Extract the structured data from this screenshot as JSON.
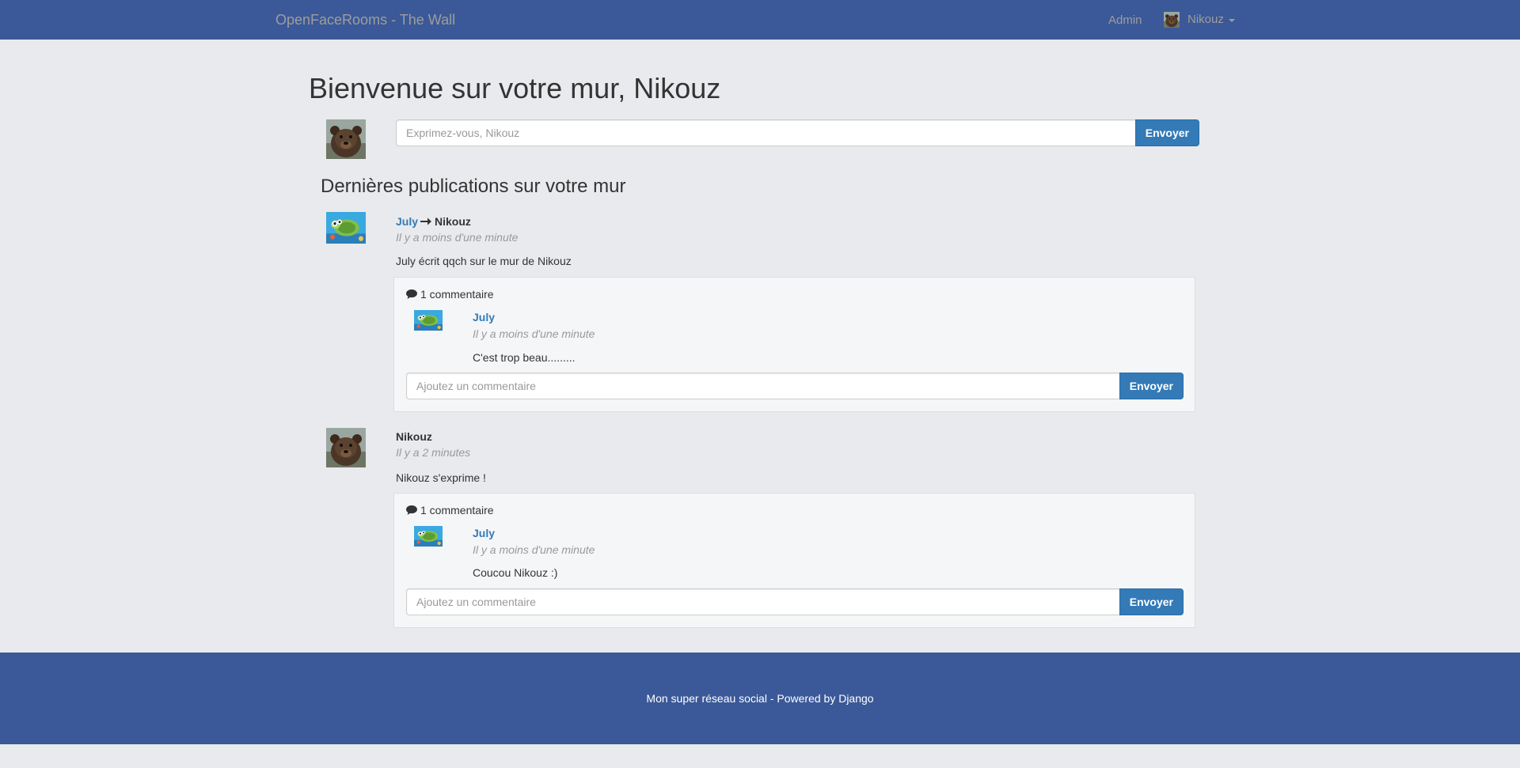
{
  "navbar": {
    "brand": "OpenFaceRooms - The Wall",
    "admin_label": "Admin",
    "user_label": "Nikouz",
    "colors": {
      "background": "#3b5998",
      "link": "#9d9d9d"
    }
  },
  "wall": {
    "title": "Bienvenue sur votre mur, Nikouz",
    "status_input": {
      "placeholder": "Exprimez-vous, Nikouz",
      "value": ""
    },
    "status_submit": "Envoyer",
    "section_title": "Dernières publications sur votre mur"
  },
  "posts": [
    {
      "author": "July",
      "recipient": "Nikouz",
      "avatar": "fish-avatar",
      "time": "Il y a moins d'une minute",
      "body": "July écrit qqch sur le mur de Nikouz",
      "comment_count": "1 commentaire",
      "comments": [
        {
          "author": "July",
          "avatar": "fish-avatar",
          "time": "Il y a moins d'une minute",
          "body": "C'est trop beau........."
        }
      ],
      "comment_input": {
        "placeholder": "Ajoutez un commentaire",
        "value": ""
      },
      "comment_submit": "Envoyer"
    },
    {
      "author": "Nikouz",
      "avatar": "bear-avatar",
      "time": "Il y a 2 minutes",
      "body": "Nikouz s'exprime !",
      "comment_count": "1 commentaire",
      "comments": [
        {
          "author": "July",
          "avatar": "fish-avatar",
          "time": "Il y a moins d'une minute",
          "body": "Coucou Nikouz :)"
        }
      ],
      "comment_input": {
        "placeholder": "Ajoutez un commentaire",
        "value": ""
      },
      "comment_submit": "Envoyer"
    }
  ],
  "footer": {
    "text": "Mon super réseau social - Powered by Django"
  },
  "colors": {
    "page_bg": "#e9eaed",
    "primary": "#337ab7",
    "muted": "#999999",
    "text": "#333333"
  }
}
